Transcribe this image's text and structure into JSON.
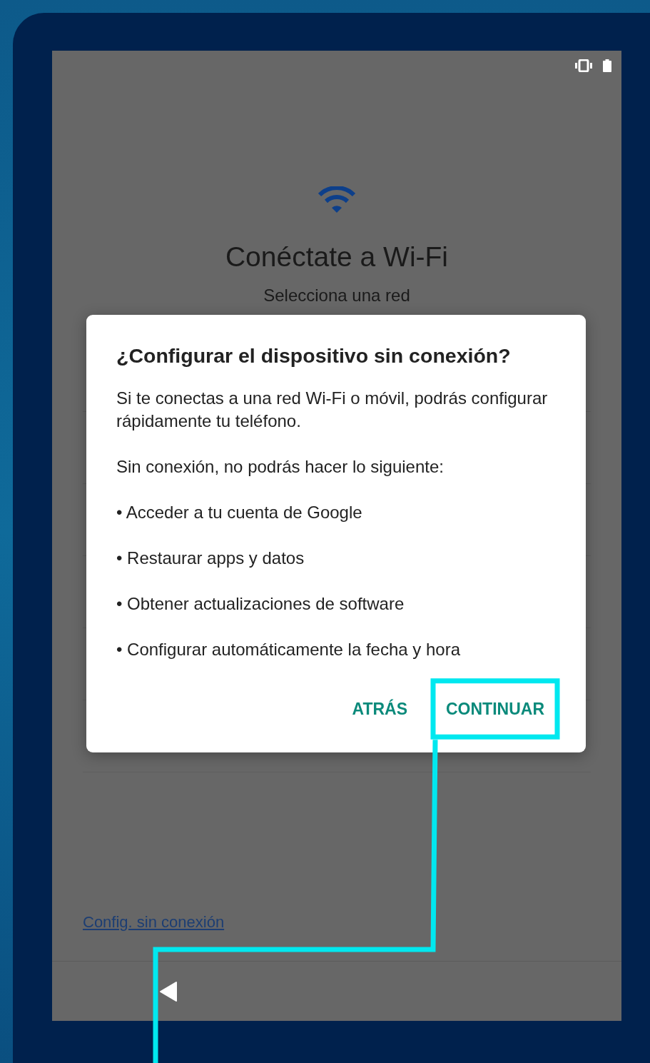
{
  "screen": {
    "title": "Conéctate a Wi-Fi",
    "subtitle": "Selecciona una red",
    "footer_link": "Config. sin conexión"
  },
  "dialog": {
    "title": "¿Configurar el dispositivo sin conexión?",
    "message": "Si te conectas a una red Wi-Fi o móvil, podrás configurar rápidamente tu teléfono.",
    "intro": "Sin conexión, no podrás hacer lo siguiente:",
    "items": [
      "• Acceder a tu cuenta de Google",
      "• Restaurar apps y datos",
      "• Obtener actualizaciones de software",
      "• Configurar automáticamente la fecha y hora"
    ],
    "buttons": [
      {
        "label": "ATRÁS",
        "highlighted": false
      },
      {
        "label": "CONTINUAR",
        "highlighted": true
      }
    ]
  }
}
